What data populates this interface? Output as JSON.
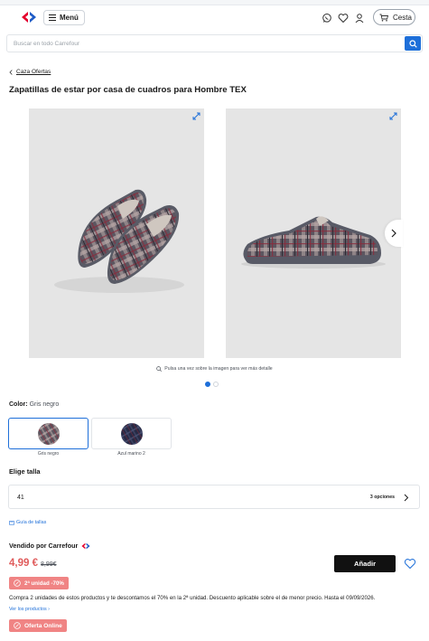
{
  "header": {
    "menu_label": "Menú",
    "cart_label": "Cesta",
    "icons": [
      "carrefour-logo",
      "whatsapp-icon",
      "heart-icon",
      "user-icon",
      "cart-icon"
    ]
  },
  "search": {
    "placeholder": "Buscar en todo Carrefour",
    "value": ""
  },
  "breadcrumb": {
    "label": "Caza Ofertas"
  },
  "product": {
    "title": "Zapatillas de estar por casa de cuadros para Hombre TEX",
    "gallery_hint": "Pulsa una vez sobre la imagen para ver más detalle",
    "gallery_count": 2,
    "gallery_active_index": 0
  },
  "color": {
    "label": "Color:",
    "selected": "Gris negro",
    "options": [
      {
        "label": "Gris negro"
      },
      {
        "label": "Azul marino 2"
      }
    ]
  },
  "size": {
    "title": "Elige talla",
    "value": "41",
    "options_label": "3 opciones",
    "guide_label": "Guía de tallas"
  },
  "seller": {
    "label": "Vendido por Carrefour"
  },
  "pricing": {
    "price": "4,99 €",
    "old_price": "8,99€",
    "add_label": "Añadir",
    "promo_badge": "2ª unidad -70%",
    "promo_text": "Compra 2 unidades de estos productos y te descontamos el 70% en la 2ª unidad. Descuento aplicable sobre el de menor precio. Hasta el 09/09/2026.",
    "see_products": "Ver los productos ›",
    "online_badge": "Oferta Online"
  },
  "colors": {
    "accent": "#1e6fd9",
    "promo": "#f08484",
    "price": "#e05c5c"
  }
}
